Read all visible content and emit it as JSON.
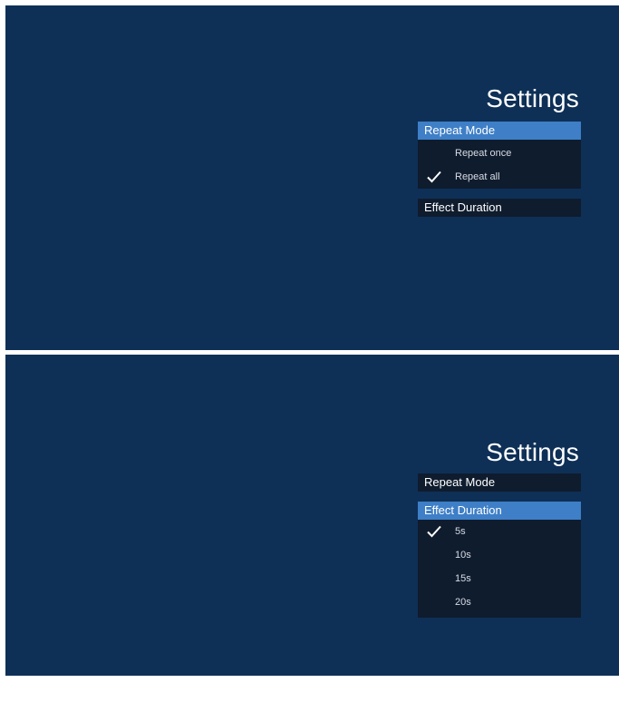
{
  "panels": [
    {
      "title": "Settings",
      "menu": {
        "repeat_mode": "Repeat Mode",
        "effect_duration": "Effect Duration"
      },
      "active_item": "repeat_mode",
      "options": [
        {
          "label": "Repeat once",
          "checked": false
        },
        {
          "label": "Repeat all",
          "checked": true
        }
      ]
    },
    {
      "title": "Settings",
      "menu": {
        "repeat_mode": "Repeat Mode",
        "effect_duration": "Effect Duration"
      },
      "active_item": "effect_duration",
      "options": [
        {
          "label": "5s",
          "checked": true
        },
        {
          "label": "10s",
          "checked": false
        },
        {
          "label": "15s",
          "checked": false
        },
        {
          "label": "20s",
          "checked": false
        }
      ]
    }
  ],
  "colors": {
    "screen_bg": "#0e3057",
    "menu_bg": "#0f1c2e",
    "active_bg": "#3e7fc7",
    "text": "#ffffff"
  },
  "icons": {
    "check": "check-icon"
  }
}
